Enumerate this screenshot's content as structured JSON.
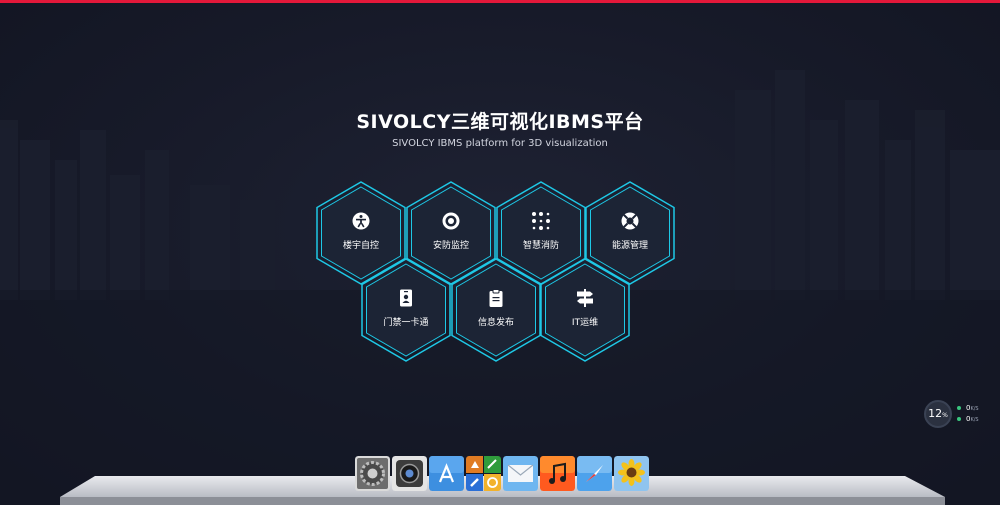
{
  "page": {
    "title": "SIVOLCY三维可视化IBMS平台",
    "subtitle": "SIVOLCY IBMS platform for 3D visualization"
  },
  "colors": {
    "accent_bar": "#e3183a",
    "hex_border": "#1ec8e6",
    "hex_fill": "#1c2435",
    "background": "#171a29"
  },
  "modules": [
    {
      "label": "楼宇自控",
      "icon": "accessibility-icon"
    },
    {
      "label": "安防监控",
      "icon": "target-icon"
    },
    {
      "label": "智慧消防",
      "icon": "dots-grid-icon"
    },
    {
      "label": "能源管理",
      "icon": "lifebuoy-icon"
    },
    {
      "label": "门禁一卡通",
      "icon": "id-badge-icon"
    },
    {
      "label": "信息发布",
      "icon": "clipboard-icon"
    },
    {
      "label": "IT运维",
      "icon": "signpost-icon"
    }
  ],
  "network_widget": {
    "percent": "12",
    "percent_unit": "%",
    "upload": "0",
    "download": "0",
    "unit": "K/S"
  },
  "dock": {
    "apps": [
      "system-preferences-icon",
      "camera-icon",
      "app-store-icon",
      "launchpad-icon",
      "mail-icon",
      "music-icon",
      "safari-icon",
      "sunflower-photo-icon"
    ]
  }
}
